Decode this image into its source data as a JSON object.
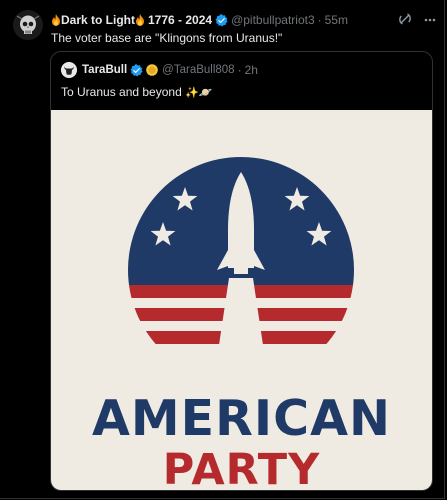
{
  "post": {
    "display_name": "Dark to Light",
    "years": "1776 - 2024",
    "handle": "@pitbullpatriot3",
    "separator": "·",
    "time": "55m",
    "text": "The voter base are \"Klingons from Uranus!\"",
    "verified_color": "#1d9bf0"
  },
  "quote": {
    "display_name": "TaraBull",
    "handle": "@TaraBull808",
    "separator": "·",
    "time": "2h",
    "text": "To Uranus and beyond",
    "text_emoji": "✨🪐"
  },
  "media": {
    "logo_line1": "AMERICAN",
    "logo_line2": "PARTY",
    "colors": {
      "navy": "#1f3a66",
      "red": "#b52a2c",
      "background": "#efebe3"
    }
  },
  "icons": {
    "fire": "fire-icon",
    "verified": "verified-badge-icon",
    "grok": "grok-icon",
    "more": "more-icon",
    "gold": "gold-badge-icon"
  }
}
